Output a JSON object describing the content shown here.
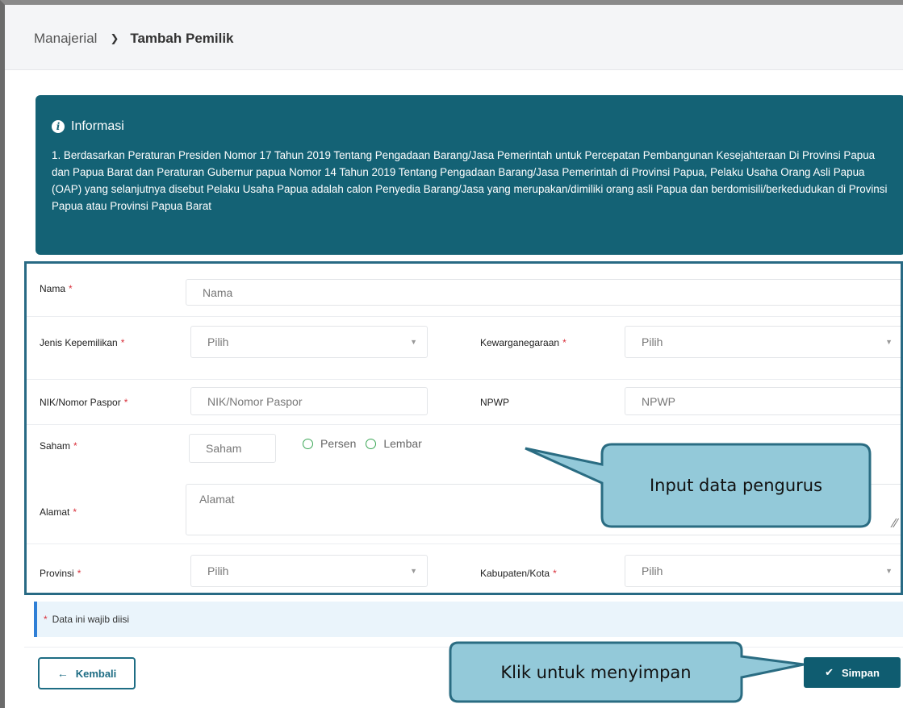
{
  "breadcrumb": {
    "parent": "Manajerial",
    "current": "Tambah Pemilik"
  },
  "info": {
    "title": "Informasi",
    "text": "1. Berdasarkan Peraturan Presiden Nomor 17 Tahun 2019 Tentang Pengadaan Barang/Jasa Pemerintah untuk Percepatan Pembangunan Kesejahteraan Di Provinsi Papua dan Papua Barat dan Peraturan Gubernur papua Nomor 14 Tahun 2019 Tentang Pengadaan Barang/Jasa Pemerintah di Provinsi Papua, Pelaku Usaha Orang Asli Papua (OAP) yang selanjutnya disebut Pelaku Usaha Papua adalah calon Penyedia Barang/Jasa yang merupakan/dimiliki orang asli Papua dan berdomisili/berkedudukan di Provinsi Papua atau Provinsi Papua Barat"
  },
  "required_mark": "*",
  "form": {
    "nama": {
      "label": "Nama",
      "placeholder": "Nama"
    },
    "jenis_kepemilikan": {
      "label": "Jenis Kepemilikan",
      "value": "Pilih"
    },
    "kewarganegaraan": {
      "label": "Kewarganegaraan",
      "value": "Pilih"
    },
    "nik": {
      "label": "NIK/Nomor Paspor",
      "placeholder": "NIK/Nomor Paspor"
    },
    "npwp": {
      "label": "NPWP",
      "placeholder": "NPWP"
    },
    "saham": {
      "label": "Saham",
      "placeholder": "Saham",
      "options": [
        "Persen",
        "Lembar"
      ]
    },
    "alamat": {
      "label": "Alamat",
      "placeholder": "Alamat"
    },
    "provinsi": {
      "label": "Provinsi",
      "value": "Pilih"
    },
    "kabupaten": {
      "label": "Kabupaten/Kota",
      "value": "Pilih"
    }
  },
  "note": "Data ini wajib diisi",
  "buttons": {
    "back": "Kembali",
    "save": "Simpan"
  },
  "callouts": {
    "input": "Input data pengurus",
    "save": "Klik untuk menyimpan"
  },
  "colors": {
    "primary": "#146275",
    "callout_fill": "#93c9d9",
    "callout_border": "#2a6c82",
    "required": "#d9303b"
  }
}
